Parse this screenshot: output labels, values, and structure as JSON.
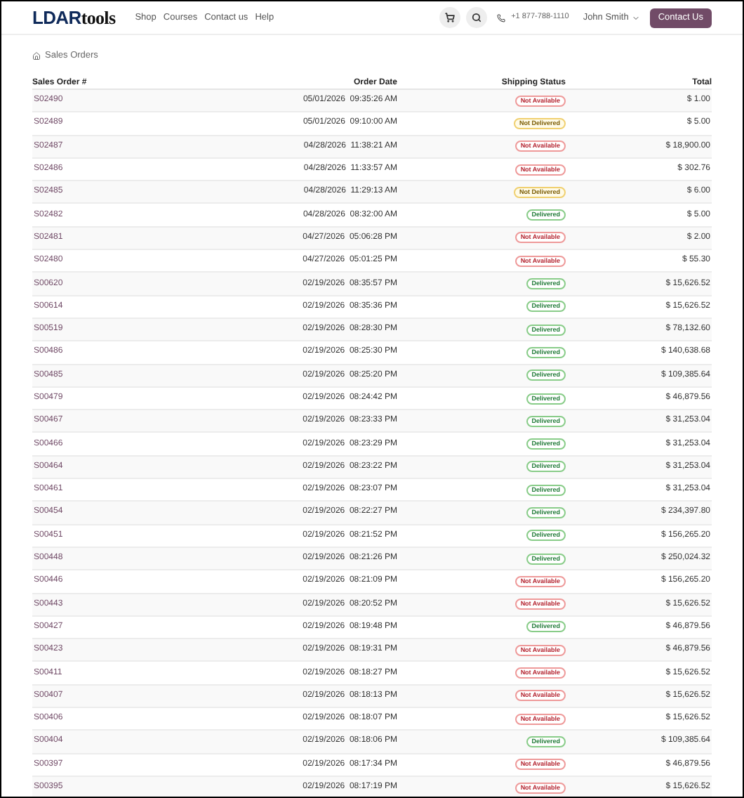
{
  "header": {
    "logo_bold": "LDAR",
    "logo_rest": "tools",
    "nav": [
      "Shop",
      "Courses",
      "Contact us",
      "Help"
    ],
    "phone": "+1 877-788-1110",
    "user": "John Smith",
    "contact_button": "Contact Us"
  },
  "breadcrumb": "Sales Orders",
  "table": {
    "columns": [
      "Sales Order #",
      "Order Date",
      "Shipping Status",
      "Total"
    ],
    "rows": [
      {
        "order": "S02490",
        "date": "05/01/2026",
        "time": "09:35:26 AM",
        "status": "Not Available",
        "kind": "na",
        "total": "$ 1.00"
      },
      {
        "order": "S02489",
        "date": "05/01/2026",
        "time": "09:10:00 AM",
        "status": "Not Delivered",
        "kind": "nd",
        "total": "$ 5.00"
      },
      {
        "order": "S02487",
        "date": "04/28/2026",
        "time": "11:38:21 AM",
        "status": "Not Available",
        "kind": "na",
        "total": "$ 18,900.00"
      },
      {
        "order": "S02486",
        "date": "04/28/2026",
        "time": "11:33:57 AM",
        "status": "Not Available",
        "kind": "na",
        "total": "$ 302.76"
      },
      {
        "order": "S02485",
        "date": "04/28/2026",
        "time": "11:29:13 AM",
        "status": "Not Delivered",
        "kind": "nd",
        "total": "$ 6.00"
      },
      {
        "order": "S02482",
        "date": "04/28/2026",
        "time": "08:32:00 AM",
        "status": "Delivered",
        "kind": "del",
        "total": "$ 5.00"
      },
      {
        "order": "S02481",
        "date": "04/27/2026",
        "time": "05:06:28 PM",
        "status": "Not Available",
        "kind": "na",
        "total": "$ 2.00"
      },
      {
        "order": "S02480",
        "date": "04/27/2026",
        "time": "05:01:25 PM",
        "status": "Not Available",
        "kind": "na",
        "total": "$ 55.30"
      },
      {
        "order": "S00620",
        "date": "02/19/2026",
        "time": "08:35:57 PM",
        "status": "Delivered",
        "kind": "del",
        "total": "$ 15,626.52"
      },
      {
        "order": "S00614",
        "date": "02/19/2026",
        "time": "08:35:36 PM",
        "status": "Delivered",
        "kind": "del",
        "total": "$ 15,626.52"
      },
      {
        "order": "S00519",
        "date": "02/19/2026",
        "time": "08:28:30 PM",
        "status": "Delivered",
        "kind": "del",
        "total": "$ 78,132.60"
      },
      {
        "order": "S00486",
        "date": "02/19/2026",
        "time": "08:25:30 PM",
        "status": "Delivered",
        "kind": "del",
        "total": "$ 140,638.68"
      },
      {
        "order": "S00485",
        "date": "02/19/2026",
        "time": "08:25:20 PM",
        "status": "Delivered",
        "kind": "del",
        "total": "$ 109,385.64"
      },
      {
        "order": "S00479",
        "date": "02/19/2026",
        "time": "08:24:42 PM",
        "status": "Delivered",
        "kind": "del",
        "total": "$ 46,879.56"
      },
      {
        "order": "S00467",
        "date": "02/19/2026",
        "time": "08:23:33 PM",
        "status": "Delivered",
        "kind": "del",
        "total": "$ 31,253.04"
      },
      {
        "order": "S00466",
        "date": "02/19/2026",
        "time": "08:23:29 PM",
        "status": "Delivered",
        "kind": "del",
        "total": "$ 31,253.04"
      },
      {
        "order": "S00464",
        "date": "02/19/2026",
        "time": "08:23:22 PM",
        "status": "Delivered",
        "kind": "del",
        "total": "$ 31,253.04"
      },
      {
        "order": "S00461",
        "date": "02/19/2026",
        "time": "08:23:07 PM",
        "status": "Delivered",
        "kind": "del",
        "total": "$ 31,253.04"
      },
      {
        "order": "S00454",
        "date": "02/19/2026",
        "time": "08:22:27 PM",
        "status": "Delivered",
        "kind": "del",
        "total": "$ 234,397.80"
      },
      {
        "order": "S00451",
        "date": "02/19/2026",
        "time": "08:21:52 PM",
        "status": "Delivered",
        "kind": "del",
        "total": "$ 156,265.20"
      },
      {
        "order": "S00448",
        "date": "02/19/2026",
        "time": "08:21:26 PM",
        "status": "Delivered",
        "kind": "del",
        "total": "$ 250,024.32"
      },
      {
        "order": "S00446",
        "date": "02/19/2026",
        "time": "08:21:09 PM",
        "status": "Not Available",
        "kind": "na",
        "total": "$ 156,265.20"
      },
      {
        "order": "S00443",
        "date": "02/19/2026",
        "time": "08:20:52 PM",
        "status": "Not Available",
        "kind": "na",
        "total": "$ 15,626.52"
      },
      {
        "order": "S00427",
        "date": "02/19/2026",
        "time": "08:19:48 PM",
        "status": "Delivered",
        "kind": "del",
        "total": "$ 46,879.56"
      },
      {
        "order": "S00423",
        "date": "02/19/2026",
        "time": "08:19:31 PM",
        "status": "Not Available",
        "kind": "na",
        "total": "$ 46,879.56"
      },
      {
        "order": "S00411",
        "date": "02/19/2026",
        "time": "08:18:27 PM",
        "status": "Not Available",
        "kind": "na",
        "total": "$ 15,626.52"
      },
      {
        "order": "S00407",
        "date": "02/19/2026",
        "time": "08:18:13 PM",
        "status": "Not Available",
        "kind": "na",
        "total": "$ 15,626.52"
      },
      {
        "order": "S00406",
        "date": "02/19/2026",
        "time": "08:18:07 PM",
        "status": "Not Available",
        "kind": "na",
        "total": "$ 15,626.52"
      },
      {
        "order": "S00404",
        "date": "02/19/2026",
        "time": "08:18:06 PM",
        "status": "Delivered",
        "kind": "del",
        "total": "$ 109,385.64"
      },
      {
        "order": "S00397",
        "date": "02/19/2026",
        "time": "08:17:34 PM",
        "status": "Not Available",
        "kind": "na",
        "total": "$ 46,879.56"
      },
      {
        "order": "S00395",
        "date": "02/19/2026",
        "time": "08:17:19 PM",
        "status": "Not Available",
        "kind": "na",
        "total": "$ 15,626.52"
      }
    ]
  }
}
